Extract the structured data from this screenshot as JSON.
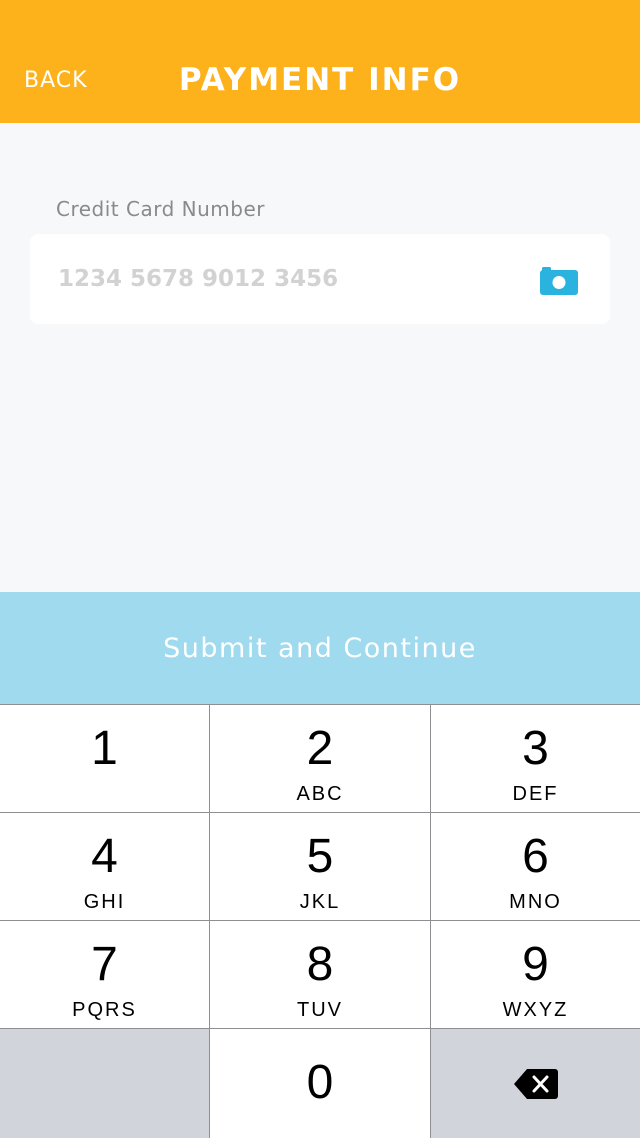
{
  "header": {
    "back_label": "BACK",
    "title": "PAYMENT INFO",
    "background": "#fdb11a"
  },
  "form": {
    "card_label": "Credit Card Number",
    "card_placeholder": "1234 5678 9012 3456",
    "card_value": "",
    "scan_icon": "camera-icon",
    "scan_icon_color": "#2bb3df"
  },
  "submit": {
    "label": "Submit and Continue",
    "background": "#a0daee"
  },
  "keypad": {
    "keys": [
      {
        "digit": "1",
        "letters": ""
      },
      {
        "digit": "2",
        "letters": "ABC"
      },
      {
        "digit": "3",
        "letters": "DEF"
      },
      {
        "digit": "4",
        "letters": "GHI"
      },
      {
        "digit": "5",
        "letters": "JKL"
      },
      {
        "digit": "6",
        "letters": "MNO"
      },
      {
        "digit": "7",
        "letters": "PQRS"
      },
      {
        "digit": "8",
        "letters": "TUV"
      },
      {
        "digit": "9",
        "letters": "WXYZ"
      },
      {
        "digit": "0",
        "letters": ""
      }
    ],
    "delete_icon": "backspace-icon"
  }
}
